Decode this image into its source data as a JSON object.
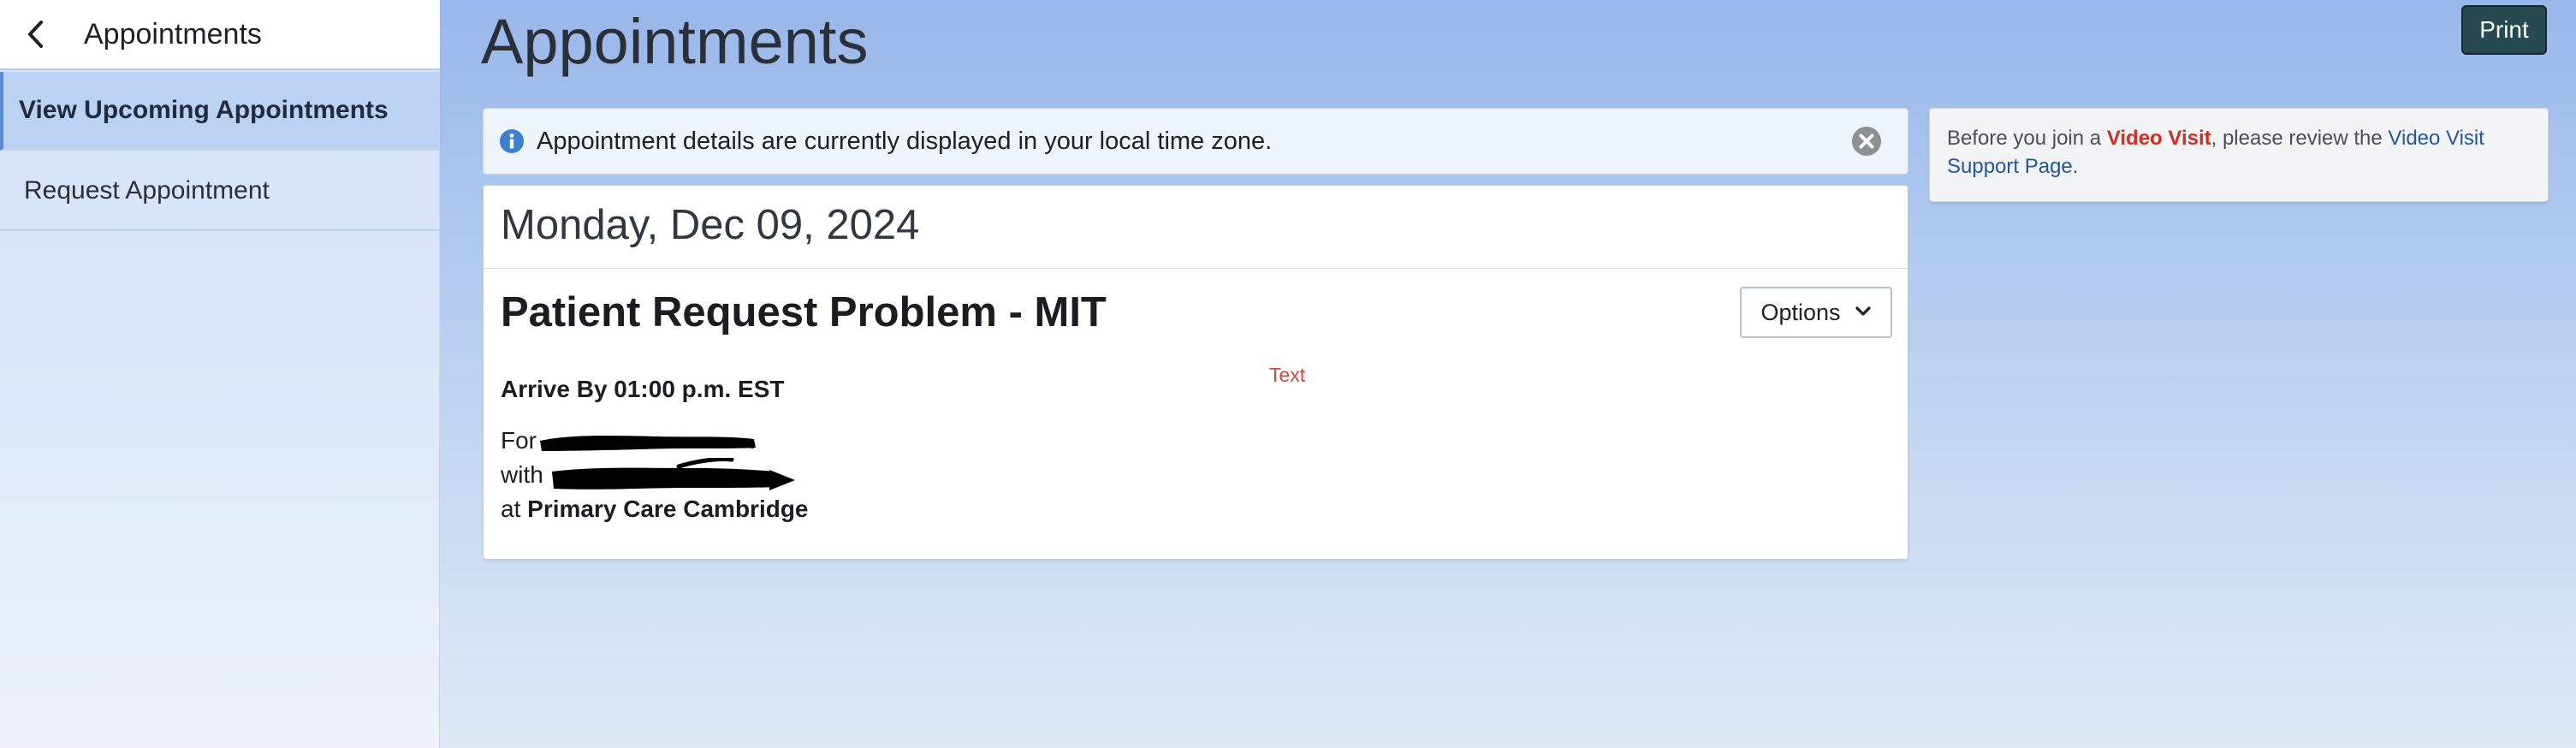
{
  "sidebar": {
    "title": "Appointments",
    "items": [
      {
        "label": "View Upcoming Appointments",
        "active": true
      },
      {
        "label": "Request Appointment",
        "active": false
      }
    ]
  },
  "header": {
    "title": "Appointments",
    "print_label": "Print"
  },
  "info_banner": {
    "icon": "info-icon",
    "text": "Appointment details are currently displayed in your local time zone."
  },
  "appointment": {
    "date": "Monday, Dec 09, 2024",
    "title": "Patient Request Problem - MIT",
    "options_label": "Options",
    "annotation_text": "Text",
    "arrive_by": "Arrive By 01:00 p.m. EST",
    "for_prefix": "For",
    "with_prefix": "with",
    "at_prefix": "at",
    "location": "Primary Care Cambridge"
  },
  "video_panel": {
    "text_before": "Before you join a ",
    "video_visit": "Video Visit",
    "text_middle": ", please review the ",
    "support_link": "Video Visit Support Page",
    "text_after": "."
  },
  "colors": {
    "accent_blue": "#5a8bd6",
    "print_button": "#264a4f",
    "video_visit_red": "#d22e22",
    "link_blue": "#24579c",
    "annotation_red": "#d6473a"
  }
}
